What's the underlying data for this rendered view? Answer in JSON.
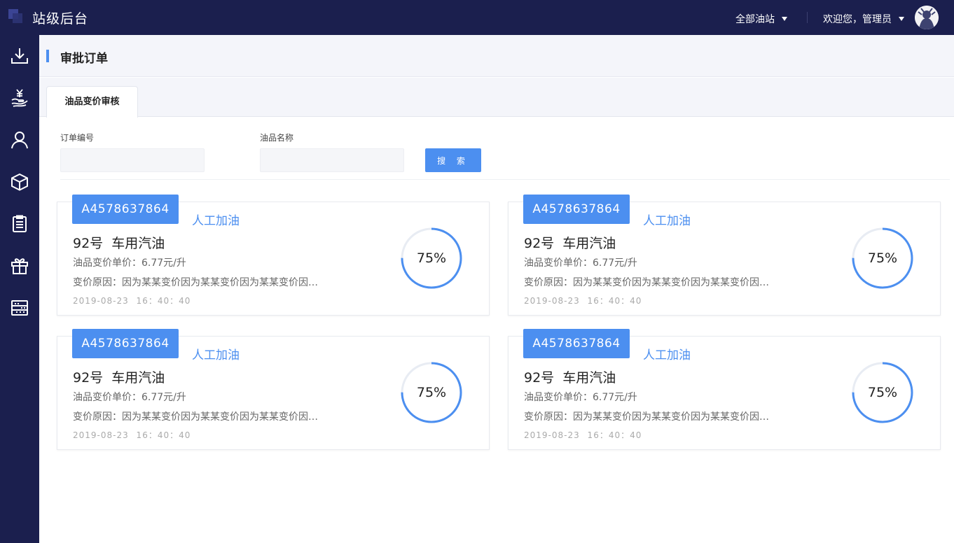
{
  "app": {
    "title": "站级后台"
  },
  "topbar": {
    "station_selector": "全部油站",
    "user_greeting": "欢迎您，管理员"
  },
  "sidebar": {
    "items": [
      {
        "icon": "download-icon"
      },
      {
        "icon": "yen-hand-icon"
      },
      {
        "icon": "user-icon"
      },
      {
        "icon": "cube-icon"
      },
      {
        "icon": "clipboard-icon"
      },
      {
        "icon": "gift-icon"
      },
      {
        "icon": "abacus-icon"
      }
    ]
  },
  "page": {
    "title": "审批订单",
    "tab": "油品变价审核"
  },
  "filters": {
    "order_no_label": "订单编号",
    "order_no_value": "",
    "product_label": "油品名称",
    "product_value": "",
    "search_label": "搜 索"
  },
  "orders": [
    {
      "order_no": "A4578637864",
      "method": "人工加油",
      "product": "92号 车用汽油",
      "price": "油品变价单价：6.77元/升",
      "reason": "变价原因：因为某某变价因为某某变价因为某某变价因为某某变价",
      "datetime": "2019-08-23 16：40：40",
      "progress_text": "75%",
      "progress": 0.75
    },
    {
      "order_no": "A4578637864",
      "method": "人工加油",
      "product": "92号 车用汽油",
      "price": "油品变价单价：6.77元/升",
      "reason": "变价原因：因为某某变价因为某某变价因为某某变价因为某某变价",
      "datetime": "2019-08-23 16：40：40",
      "progress_text": "75%",
      "progress": 0.75
    },
    {
      "order_no": "A4578637864",
      "method": "人工加油",
      "product": "92号 车用汽油",
      "price": "油品变价单价：6.77元/升",
      "reason": "变价原因：因为某某变价因为某某变价因为某某变价因为某某变价",
      "datetime": "2019-08-23 16：40：40",
      "progress_text": "75%",
      "progress": 0.75
    },
    {
      "order_no": "A4578637864",
      "method": "人工加油",
      "product": "92号 车用汽油",
      "price": "油品变价单价：6.77元/升",
      "reason": "变价原因：因为某某变价因为某某变价因为某某变价因为某某变价",
      "datetime": "2019-08-23 16：40：40",
      "progress_text": "75%",
      "progress": 0.75
    }
  ],
  "colors": {
    "accent": "#4c8ff0",
    "nav_bg": "#1b1f4e",
    "ring_track": "#e8ecf3"
  }
}
